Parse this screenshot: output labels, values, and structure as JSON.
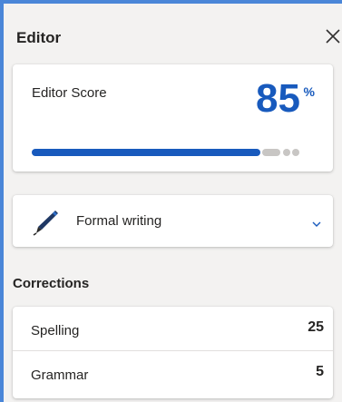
{
  "pane": {
    "title": "Editor",
    "close_icon": "close-icon"
  },
  "score": {
    "label": "Editor Score",
    "value": "85",
    "unit": "%",
    "progress": 0.85,
    "accent": "#185abd"
  },
  "writing_mode": {
    "label": "Formal writing",
    "icon": "pen-icon",
    "dropdown_icon": "chevron-down-icon"
  },
  "corrections": {
    "title": "Corrections",
    "items": [
      {
        "label": "Spelling",
        "count": "25"
      },
      {
        "label": "Grammar",
        "count": "5"
      }
    ]
  }
}
